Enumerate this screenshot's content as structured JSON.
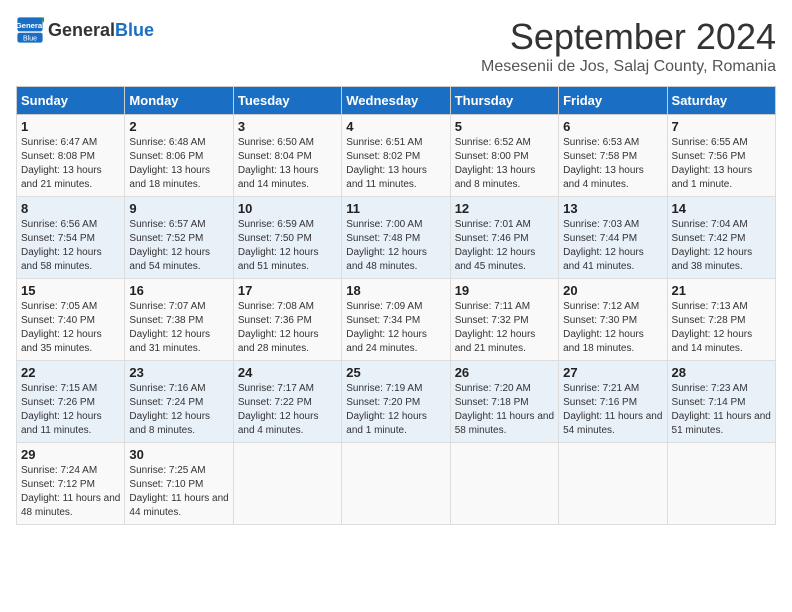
{
  "header": {
    "logo_general": "General",
    "logo_blue": "Blue",
    "month_title": "September 2024",
    "location": "Mesesenii de Jos, Salaj County, Romania"
  },
  "weekdays": [
    "Sunday",
    "Monday",
    "Tuesday",
    "Wednesday",
    "Thursday",
    "Friday",
    "Saturday"
  ],
  "weeks": [
    [
      {
        "day": "1",
        "sunrise": "6:47 AM",
        "sunset": "8:08 PM",
        "daylight": "13 hours and 21 minutes."
      },
      {
        "day": "2",
        "sunrise": "6:48 AM",
        "sunset": "8:06 PM",
        "daylight": "13 hours and 18 minutes."
      },
      {
        "day": "3",
        "sunrise": "6:50 AM",
        "sunset": "8:04 PM",
        "daylight": "13 hours and 14 minutes."
      },
      {
        "day": "4",
        "sunrise": "6:51 AM",
        "sunset": "8:02 PM",
        "daylight": "13 hours and 11 minutes."
      },
      {
        "day": "5",
        "sunrise": "6:52 AM",
        "sunset": "8:00 PM",
        "daylight": "13 hours and 8 minutes."
      },
      {
        "day": "6",
        "sunrise": "6:53 AM",
        "sunset": "7:58 PM",
        "daylight": "13 hours and 4 minutes."
      },
      {
        "day": "7",
        "sunrise": "6:55 AM",
        "sunset": "7:56 PM",
        "daylight": "13 hours and 1 minute."
      }
    ],
    [
      {
        "day": "8",
        "sunrise": "6:56 AM",
        "sunset": "7:54 PM",
        "daylight": "12 hours and 58 minutes."
      },
      {
        "day": "9",
        "sunrise": "6:57 AM",
        "sunset": "7:52 PM",
        "daylight": "12 hours and 54 minutes."
      },
      {
        "day": "10",
        "sunrise": "6:59 AM",
        "sunset": "7:50 PM",
        "daylight": "12 hours and 51 minutes."
      },
      {
        "day": "11",
        "sunrise": "7:00 AM",
        "sunset": "7:48 PM",
        "daylight": "12 hours and 48 minutes."
      },
      {
        "day": "12",
        "sunrise": "7:01 AM",
        "sunset": "7:46 PM",
        "daylight": "12 hours and 45 minutes."
      },
      {
        "day": "13",
        "sunrise": "7:03 AM",
        "sunset": "7:44 PM",
        "daylight": "12 hours and 41 minutes."
      },
      {
        "day": "14",
        "sunrise": "7:04 AM",
        "sunset": "7:42 PM",
        "daylight": "12 hours and 38 minutes."
      }
    ],
    [
      {
        "day": "15",
        "sunrise": "7:05 AM",
        "sunset": "7:40 PM",
        "daylight": "12 hours and 35 minutes."
      },
      {
        "day": "16",
        "sunrise": "7:07 AM",
        "sunset": "7:38 PM",
        "daylight": "12 hours and 31 minutes."
      },
      {
        "day": "17",
        "sunrise": "7:08 AM",
        "sunset": "7:36 PM",
        "daylight": "12 hours and 28 minutes."
      },
      {
        "day": "18",
        "sunrise": "7:09 AM",
        "sunset": "7:34 PM",
        "daylight": "12 hours and 24 minutes."
      },
      {
        "day": "19",
        "sunrise": "7:11 AM",
        "sunset": "7:32 PM",
        "daylight": "12 hours and 21 minutes."
      },
      {
        "day": "20",
        "sunrise": "7:12 AM",
        "sunset": "7:30 PM",
        "daylight": "12 hours and 18 minutes."
      },
      {
        "day": "21",
        "sunrise": "7:13 AM",
        "sunset": "7:28 PM",
        "daylight": "12 hours and 14 minutes."
      }
    ],
    [
      {
        "day": "22",
        "sunrise": "7:15 AM",
        "sunset": "7:26 PM",
        "daylight": "12 hours and 11 minutes."
      },
      {
        "day": "23",
        "sunrise": "7:16 AM",
        "sunset": "7:24 PM",
        "daylight": "12 hours and 8 minutes."
      },
      {
        "day": "24",
        "sunrise": "7:17 AM",
        "sunset": "7:22 PM",
        "daylight": "12 hours and 4 minutes."
      },
      {
        "day": "25",
        "sunrise": "7:19 AM",
        "sunset": "7:20 PM",
        "daylight": "12 hours and 1 minute."
      },
      {
        "day": "26",
        "sunrise": "7:20 AM",
        "sunset": "7:18 PM",
        "daylight": "11 hours and 58 minutes."
      },
      {
        "day": "27",
        "sunrise": "7:21 AM",
        "sunset": "7:16 PM",
        "daylight": "11 hours and 54 minutes."
      },
      {
        "day": "28",
        "sunrise": "7:23 AM",
        "sunset": "7:14 PM",
        "daylight": "11 hours and 51 minutes."
      }
    ],
    [
      {
        "day": "29",
        "sunrise": "7:24 AM",
        "sunset": "7:12 PM",
        "daylight": "11 hours and 48 minutes."
      },
      {
        "day": "30",
        "sunrise": "7:25 AM",
        "sunset": "7:10 PM",
        "daylight": "11 hours and 44 minutes."
      },
      null,
      null,
      null,
      null,
      null
    ]
  ]
}
